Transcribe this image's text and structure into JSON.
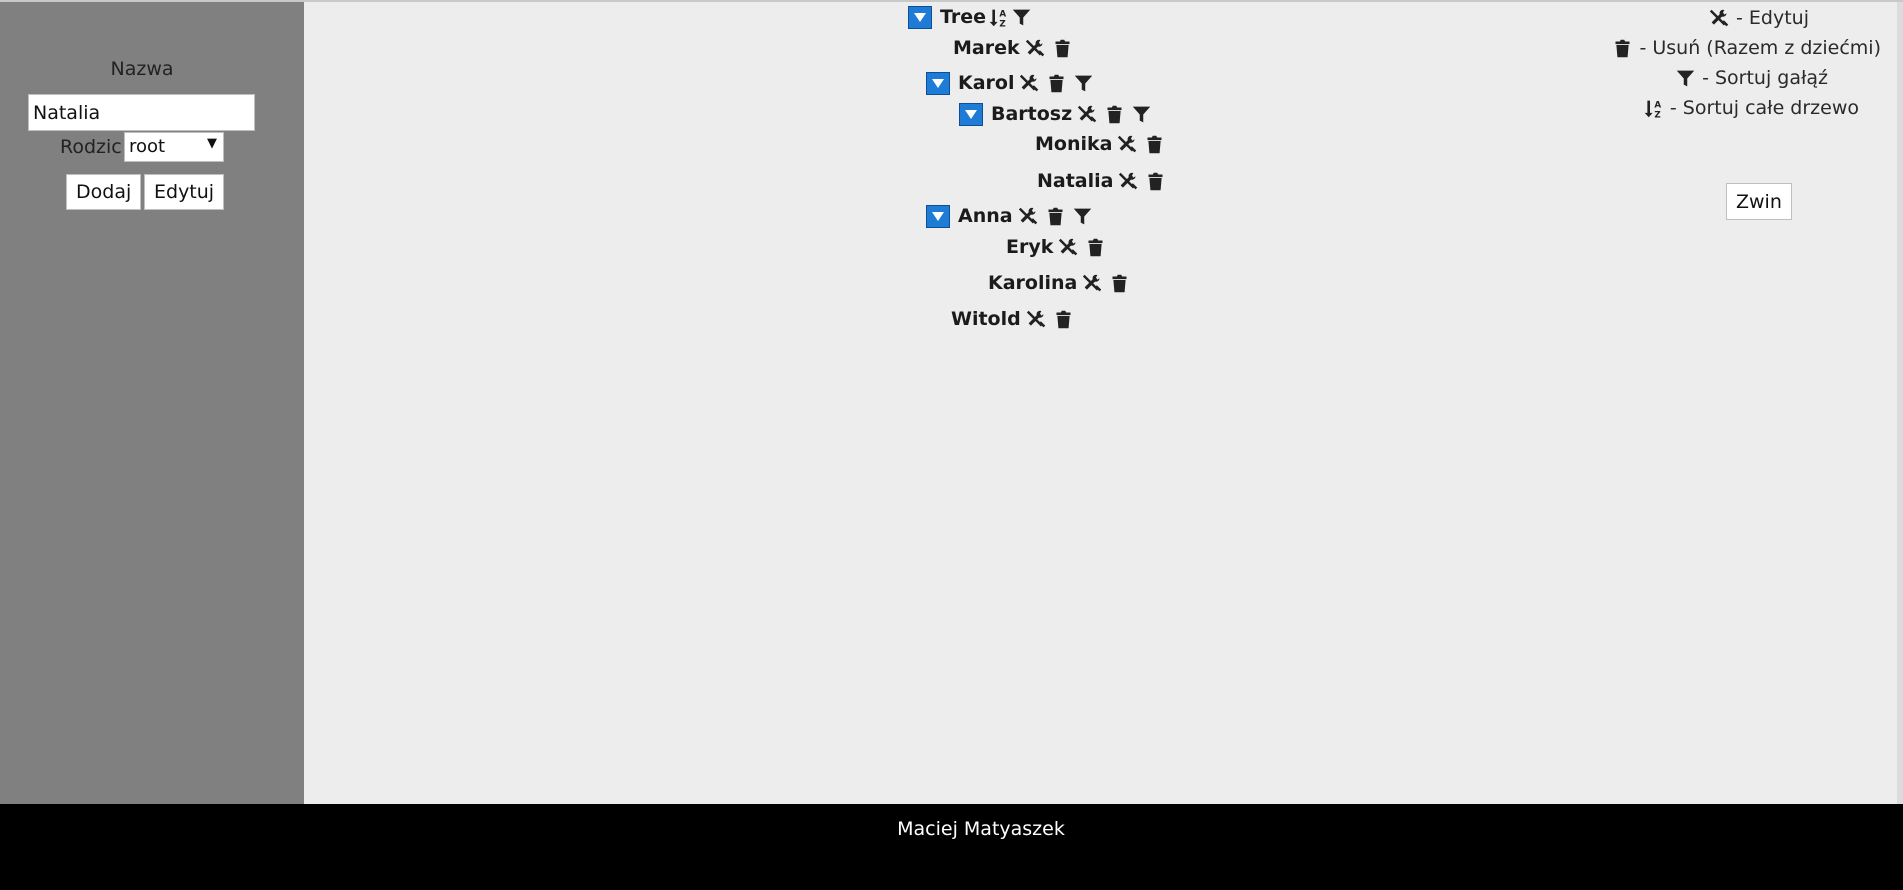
{
  "sidebar": {
    "name_label": "Nazwa",
    "name_value": "Natalia",
    "parent_label": "Rodzic",
    "parent_value": "root",
    "add_label": "Dodaj",
    "edit_label": "Edytuj"
  },
  "tree": {
    "root": "Tree",
    "nodes": [
      "Marek",
      "Karol",
      "Bartosz",
      "Monika",
      "Natalia",
      "Anna",
      "Eryk",
      "Karolina",
      "Witold"
    ]
  },
  "legend": {
    "edit": "- Edytuj",
    "delete": "- Usuń (Razem z dziećmi)",
    "sort_branch": "- Sortuj gałąź",
    "sort_tree": "- Sortuj całe drzewo",
    "collapse_label": "Zwin"
  },
  "footer": {
    "author": "Maciej Matyaszek"
  },
  "colors": {
    "sidebar": "#808080",
    "main": "#ededed",
    "footer": "#000000",
    "toggle": "#1e7bd6"
  }
}
